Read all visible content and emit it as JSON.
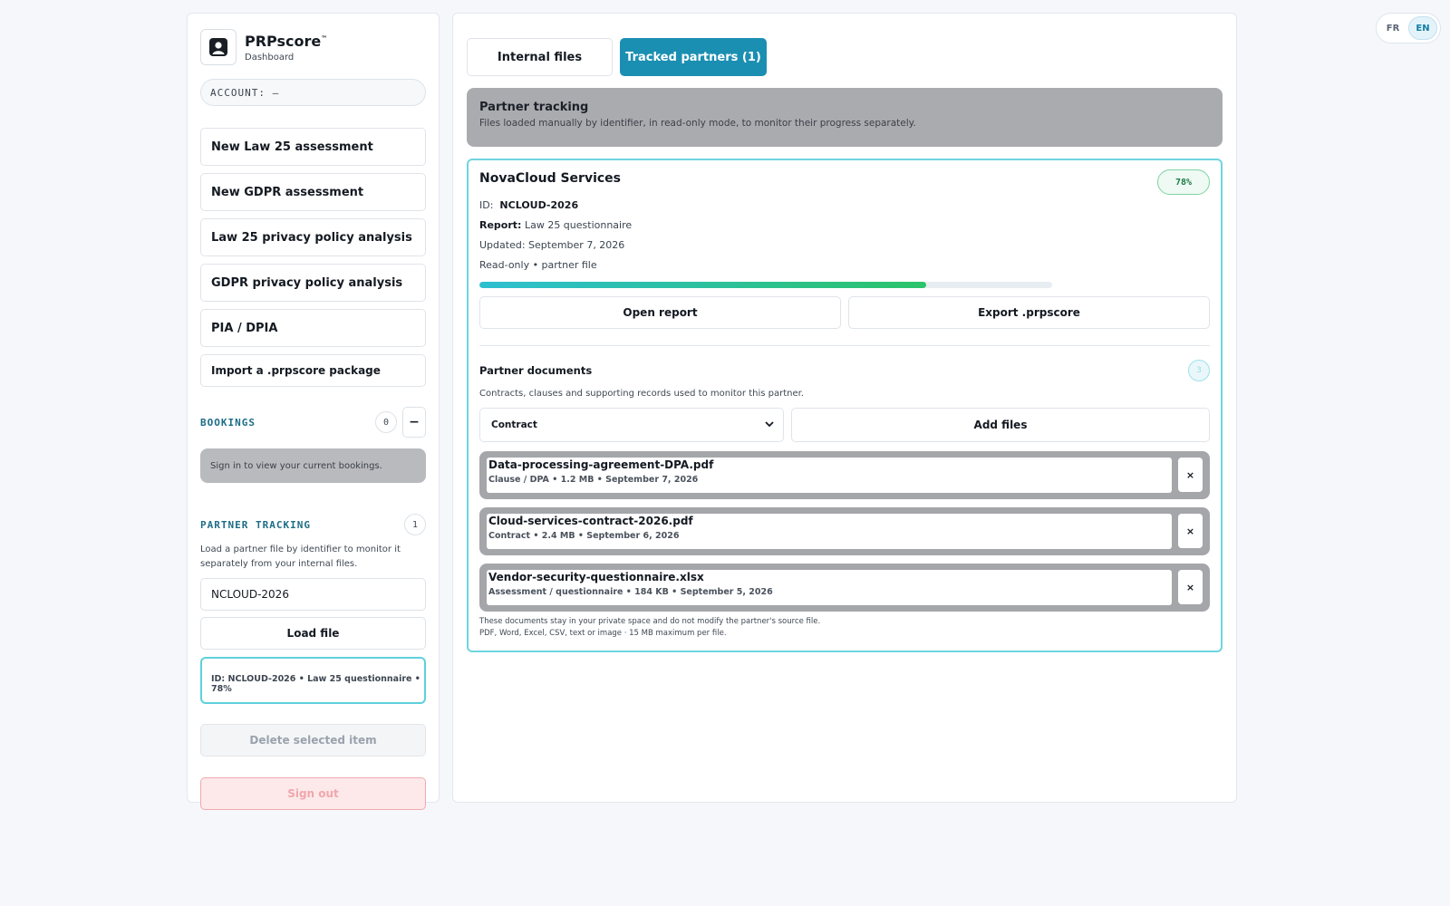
{
  "lang": {
    "options": [
      "FR",
      "EN"
    ],
    "active": "EN"
  },
  "sidebar": {
    "brand_name": "PRPscore",
    "brand_tm": "™",
    "brand_sub": "Dashboard",
    "account": "ACCOUNT: —",
    "menu": [
      "New Law 25 assessment",
      "New GDPR assessment",
      "Law 25 privacy policy analysis",
      "GDPR privacy policy analysis",
      "PIA / DPIA"
    ],
    "import_label": "Import a .prpscore package",
    "bookings": {
      "title": "BOOKINGS",
      "count": "0",
      "collapse": "−",
      "message": "Sign in to view your current bookings."
    },
    "tracking": {
      "title": "PARTNER TRACKING",
      "count": "1",
      "description": "Load a partner file by identifier to monitor it separately from your internal files.",
      "input_value": "NCLOUD-2026",
      "load_label": "Load file",
      "item": "ID: NCLOUD-2026 • Law 25 questionnaire • 78%"
    },
    "delete_label": "Delete selected item",
    "signout_label": "Sign out"
  },
  "main": {
    "tabs": [
      "Internal files",
      "Tracked partners (1)"
    ],
    "banner": {
      "title": "Partner tracking",
      "subtitle": "Files loaded manually by identifier, in read-only mode, to monitor their progress separately."
    },
    "partner": {
      "name": "NovaCloud Services",
      "percent_label": "78%",
      "progress": 0.78,
      "id_label": "ID:",
      "id_value": "NCLOUD-2026",
      "report_label": "Report:",
      "report_value": "Law 25 questionnaire",
      "updated": "Updated: September 7, 2026",
      "mode": "Read-only • partner file",
      "open_label": "Open report",
      "export_label": "Export .prpscore"
    },
    "documents": {
      "title": "Partner documents",
      "count": "3",
      "description": "Contracts, clauses and supporting records used to monitor this partner.",
      "type_selected": "Contract",
      "add_label": "Add files",
      "remove_label": "×",
      "files": [
        {
          "name": "Data-processing-agreement-DPA.pdf",
          "meta": "Clause / DPA • 1.2 MB • September 7, 2026"
        },
        {
          "name": "Cloud-services-contract-2026.pdf",
          "meta": "Contract • 2.4 MB • September 6, 2026"
        },
        {
          "name": "Vendor-security-questionnaire.xlsx",
          "meta": "Assessment / questionnaire • 184 KB • September 5, 2026"
        }
      ],
      "footnote_1": "These documents stay in your private space and do not modify the partner's source file.",
      "footnote_2": "PDF, Word, Excel, CSV, text or image · 15 MB maximum per file."
    }
  },
  "colors": {
    "accent": "#1b8fb2",
    "progress_start": "#2dbfd1",
    "progress_end": "#2bc36a",
    "highlight_border": "#6fd5df"
  }
}
